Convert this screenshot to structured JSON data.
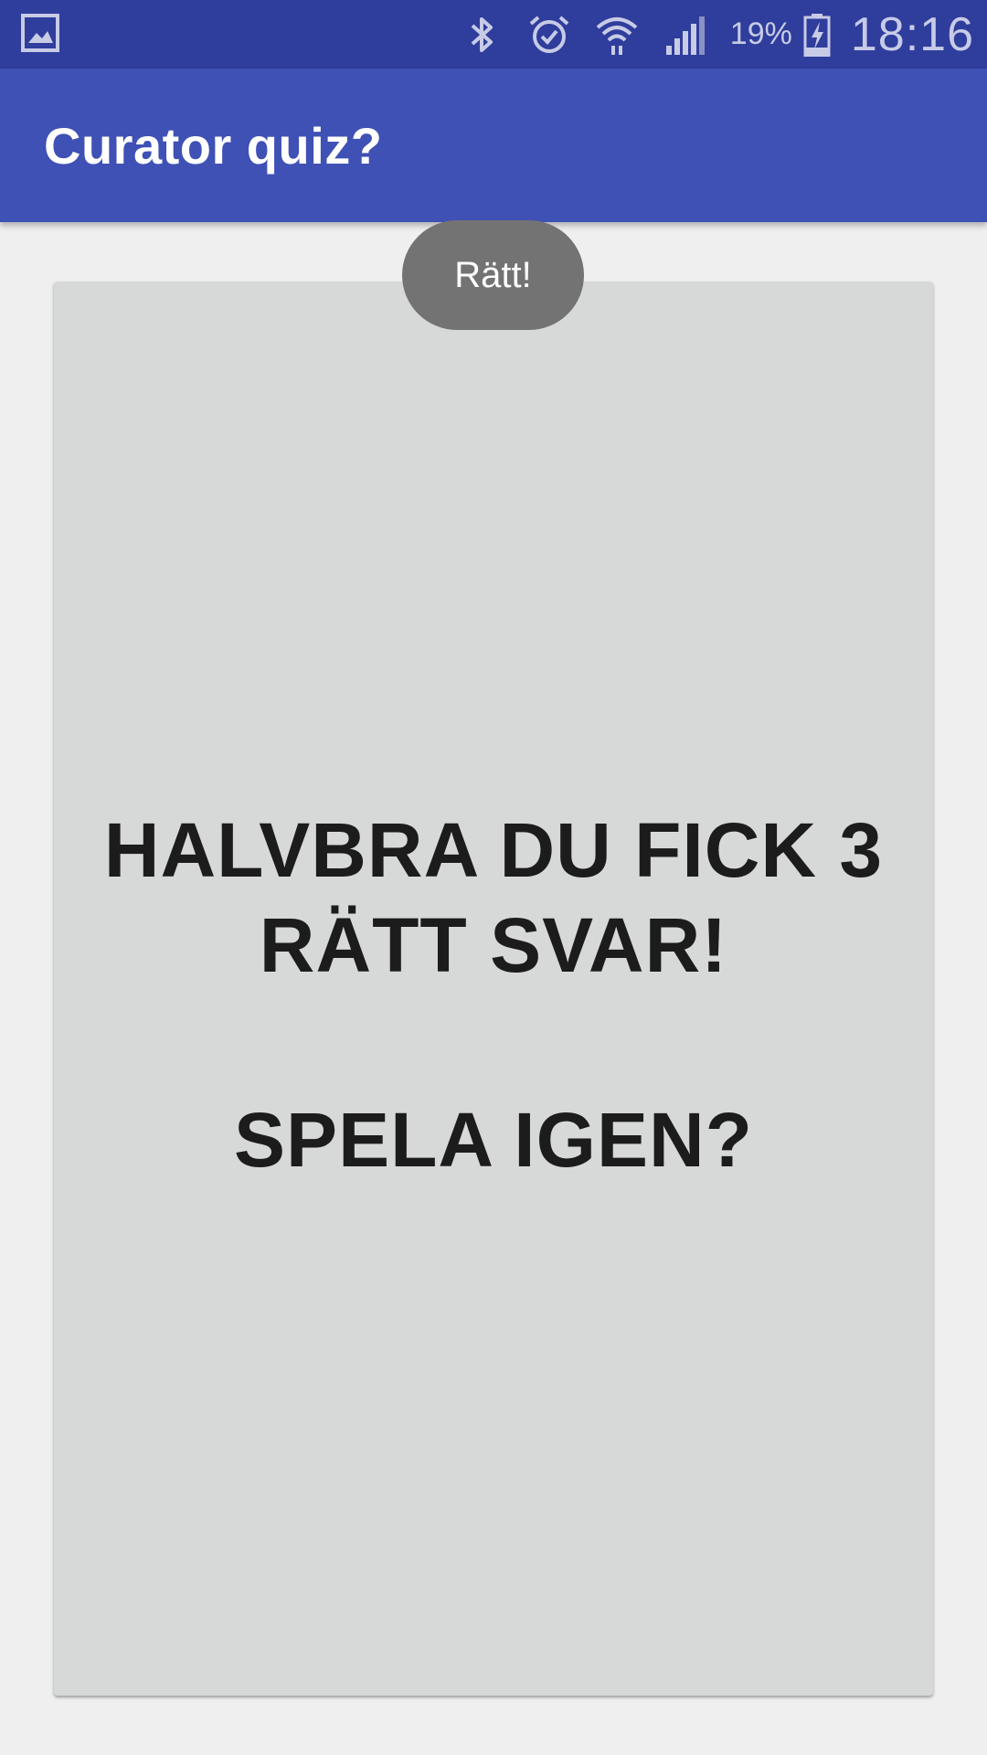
{
  "status_bar": {
    "battery_percent": "19%",
    "time": "18:16",
    "icons": [
      "gallery-notification-icon",
      "bluetooth-icon",
      "alarm-icon",
      "wifi-icon",
      "signal-icon",
      "battery-charging-icon"
    ]
  },
  "app_bar": {
    "title": "Curator quiz?"
  },
  "card": {
    "result_line1": "HALVBRA DU FICK 3",
    "result_line2": "RÄTT SVAR!",
    "replay": "SPELA IGEN?"
  },
  "toast": {
    "message": "Rätt!"
  },
  "colors": {
    "status_bar": "#2f3d9c",
    "app_bar": "#3f51b5",
    "background": "#efefef",
    "card": "#d7d8d8",
    "toast": "#737373"
  }
}
